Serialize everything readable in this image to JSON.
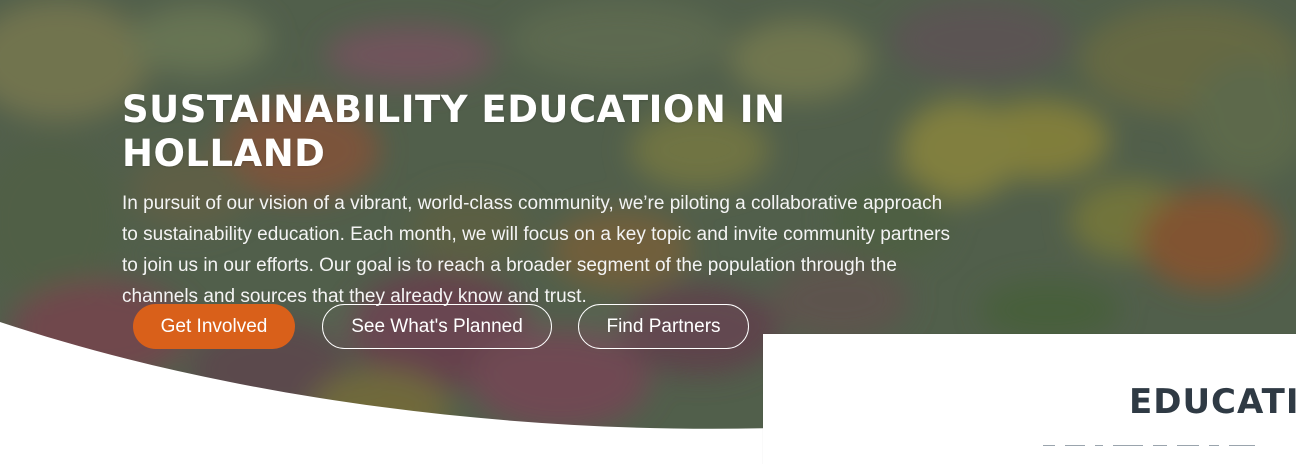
{
  "hero": {
    "title": "SUSTAINABILITY EDUCATION IN HOLLAND",
    "description": "In pursuit of our vision of a vibrant, world-class community, we’re piloting a collaborative approach to sustainability education. Each month, we will focus on a key topic and invite community partners to join us in our efforts. Our goal is to reach a broader segment of the population through the channels and sources that they already know and trust.",
    "buttons": {
      "get_involved": "Get Involved",
      "see_planned": "See What's Planned",
      "find_partners": "Find Partners"
    }
  },
  "card": {
    "title": "EDUCATI"
  },
  "colors": {
    "accent": "#d9601a",
    "overlay": "#44533f",
    "heading_dark": "#2f3a44"
  }
}
